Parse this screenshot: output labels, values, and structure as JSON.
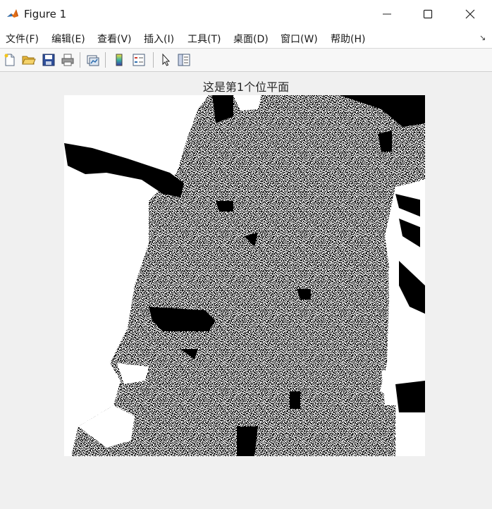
{
  "window": {
    "title": "Figure 1",
    "app_icon": "matlab-icon"
  },
  "menubar": {
    "items": [
      "文件(F)",
      "编辑(E)",
      "查看(V)",
      "插入(I)",
      "工具(T)",
      "桌面(D)",
      "窗口(W)",
      "帮助(H)"
    ],
    "dock_glyph": "↘"
  },
  "toolbar": {
    "buttons": [
      "new-figure-icon",
      "open-file-icon",
      "save-icon",
      "print-icon",
      "link-plot-icon",
      "colorbar-icon",
      "legend-icon",
      "edit-plot-arrow-icon",
      "property-inspector-icon"
    ]
  },
  "figure": {
    "title": "这是第1个位平面",
    "image_content": "binary bit-plane image (black/white noise texture)"
  },
  "colors": {
    "background": "#f0f0f0",
    "titlebar": "#ffffff",
    "matlab_orange": "#e16d16"
  }
}
